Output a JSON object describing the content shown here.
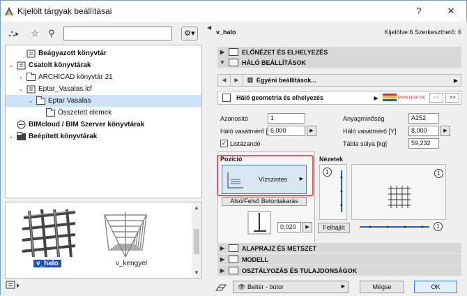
{
  "window": {
    "title": "Kijelölt tárgyak beállításai",
    "help": "?",
    "close": "✕"
  },
  "left": {
    "toolbar": {
      "tree_view": "⛬▸",
      "favorites": "☆",
      "search": "⚲",
      "search_value": "",
      "gear": "⚙▾"
    },
    "tree": [
      {
        "label": "Beágyazott könyvtár",
        "bold": true,
        "indent": 1,
        "arrow": "",
        "icon": "lib"
      },
      {
        "label": "Csatolt könyvtárak",
        "bold": true,
        "indent": 0,
        "arrow": "⌄",
        "icon": "lib"
      },
      {
        "label": "ARCHICAD könyvtár 21",
        "bold": false,
        "indent": 1,
        "arrow": "›",
        "icon": "folder"
      },
      {
        "label": "Eptar_Vasalas.lcf",
        "bold": false,
        "indent": 1,
        "arrow": "⌄",
        "icon": "lcf"
      },
      {
        "label": "Eptar Vasalas",
        "bold": false,
        "indent": 2,
        "arrow": "⌄",
        "icon": "folder",
        "selected": true
      },
      {
        "label": "Összetett elemek",
        "bold": false,
        "indent": 3,
        "arrow": "",
        "icon": "folder"
      },
      {
        "label": "BIMcloud / BIM Szerver könyvtárak",
        "bold": true,
        "indent": 0,
        "arrow": "",
        "icon": "cloud"
      },
      {
        "label": "Beépített könyvtárak",
        "bold": true,
        "indent": 0,
        "arrow": "›",
        "icon": "folderdark"
      }
    ],
    "thumbnails": [
      {
        "label": "v_halo",
        "selected": true
      },
      {
        "label": "v_kengyel",
        "selected": false
      }
    ],
    "bottom_icon": "library-manager-icon"
  },
  "right": {
    "header": {
      "name": "v_halo",
      "status": "Kijelölve:6 Szerkeszthető: 6"
    },
    "sections": {
      "preview": "ELŐNÉZET ÉS ELHELYEZÉS",
      "mesh": "HÁLÓ BEÁLLÍTÁSOK",
      "plan": "ALAPRAJZ ÉS METSZET",
      "model": "MODELL",
      "classification": "OSZTÁLYOZÁS ÉS TULAJDONSÁGOK"
    },
    "subbar": {
      "label": "Egyéni beállítások..."
    },
    "geometry": {
      "label": "Háló geometria és elhelyezés",
      "logo": "[www.eptar.hu]",
      "prev": "<<",
      "next": ">>"
    },
    "fields": {
      "id_label": "Azonosító",
      "id_value": "1",
      "material_label": "Anyagminőség",
      "material_value": "A252",
      "dia_x_label": "Háló vasátmérő [X]",
      "dia_x_value": "6,000",
      "dia_y_label": "Háló vasátmérő [Y]",
      "dia_y_value": "8,000",
      "listable_label": "Listázandó",
      "weight_label": "Tábla súlya [kg]",
      "weight_value": "59,232"
    },
    "position": {
      "title": "Pozíció",
      "mode": "Vízszintes",
      "bottom_btn": "Alsó/Felső Betontakarás",
      "cover_value": "0,020",
      "bent_btn": "Felhajlít"
    },
    "views": {
      "title": "Nézetek",
      "badge1": "1",
      "badge2": "1",
      "badge3": "1"
    },
    "footer": {
      "layer": "Beltér - bútor",
      "cancel": "Mégse",
      "ok": "OK"
    }
  }
}
